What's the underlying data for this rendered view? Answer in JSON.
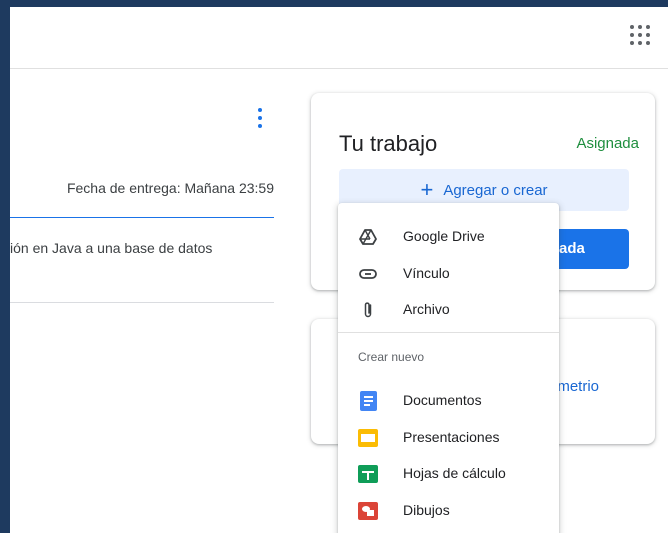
{
  "header": {
    "apps_icon": "apps-grid-icon"
  },
  "assignment": {
    "more_icon": "more-vert-icon",
    "due": "Fecha de entrega: Mañana 23:59",
    "description": "ión en Java a una base de datos"
  },
  "work_card": {
    "title": "Tu trabajo",
    "status": "Asignada",
    "add_label": "Agregar o crear",
    "primary_partial": "ada"
  },
  "second_card": {
    "partial_text": "emetrio"
  },
  "add_menu": {
    "items": [
      {
        "label": "Google Drive",
        "icon": "google-drive-icon"
      },
      {
        "label": "Vínculo",
        "icon": "link-icon"
      },
      {
        "label": "Archivo",
        "icon": "attachment-icon"
      }
    ],
    "section_label": "Crear nuevo",
    "create_items": [
      {
        "label": "Documentos",
        "icon": "docs-icon",
        "color": "#4285f4"
      },
      {
        "label": "Presentaciones",
        "icon": "slides-icon",
        "color": "#fbbc04"
      },
      {
        "label": "Hojas de cálculo",
        "icon": "sheets-icon",
        "color": "#0f9d58"
      },
      {
        "label": "Dibujos",
        "icon": "drawings-icon",
        "color": "#db4437"
      }
    ]
  },
  "colors": {
    "accent": "#1a73e8",
    "status_green": "#1e8e3e",
    "frame": "#1e3a5f"
  }
}
